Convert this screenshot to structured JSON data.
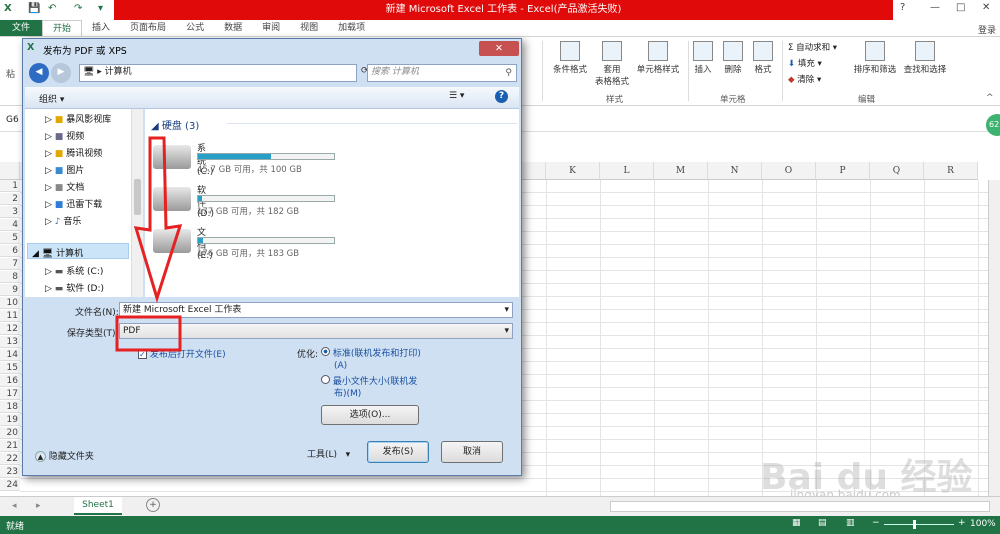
{
  "window": {
    "title": "新建 Microsoft Excel 工作表 - Excel(产品激活失败)",
    "controls": [
      "?",
      "—",
      "□",
      "✕"
    ]
  },
  "ribbon_tabs": [
    "文件",
    "开始",
    "插入",
    "页面布局",
    "公式",
    "数据",
    "审阅",
    "视图",
    "加载项"
  ],
  "signin": "登录",
  "ribbon": {
    "paste_partial": "粘",
    "styles": {
      "cond_format": "条件格式",
      "table_format_1": "套用",
      "table_format_2": "表格格式",
      "cell_style": "单元格样式",
      "group": "样式"
    },
    "cells": {
      "insert": "插入",
      "delete": "删除",
      "format": "格式",
      "group": "单元格"
    },
    "editing": {
      "autosum": "自动求和",
      "fill": "填充",
      "clear": "清除",
      "sort": "排序和筛选",
      "find": "查找和选择",
      "group": "编辑"
    }
  },
  "name_box_partial": "G6",
  "columns": [
    "K",
    "L",
    "M",
    "N",
    "O",
    "P",
    "Q",
    "R"
  ],
  "rows": [
    "1",
    "2",
    "3",
    "4",
    "5",
    "6",
    "7",
    "8",
    "9",
    "10",
    "11",
    "12",
    "13",
    "14",
    "15",
    "16",
    "17",
    "18",
    "19",
    "20",
    "21",
    "22",
    "23",
    "24"
  ],
  "sheet_tab": "Sheet1",
  "status": {
    "ready": "就绪",
    "zoom": "100%"
  },
  "dialog": {
    "title": "发布为 PDF 或 XPS",
    "breadcrumb": "计算机",
    "search_placeholder": "搜索 计算机",
    "organize": "组织",
    "section_header": "硬盘 (3)",
    "nav": [
      {
        "label": "暴风影视库",
        "icon": "folder-icon"
      },
      {
        "label": "视频",
        "icon": "video-icon"
      },
      {
        "label": "腾讯视频",
        "icon": "folder-icon"
      },
      {
        "label": "图片",
        "icon": "picture-icon"
      },
      {
        "label": "文档",
        "icon": "document-icon"
      },
      {
        "label": "迅雷下载",
        "icon": "download-icon"
      },
      {
        "label": "音乐",
        "icon": "music-icon"
      },
      {
        "label": "计算机",
        "icon": "computer-icon"
      },
      {
        "label": "系统 (C:)",
        "icon": "drive-icon"
      },
      {
        "label": "软件 (D:)",
        "icon": "drive-icon"
      }
    ],
    "drives": [
      {
        "name": "系统 (C:)",
        "info": "45.7 GB 可用，共 100 GB",
        "used": 0.54
      },
      {
        "name": "软件 (D:)",
        "info": "177 GB 可用，共 182 GB",
        "used": 0.03
      },
      {
        "name": "文档 (E:)",
        "info": "176 GB 可用，共 183 GB",
        "used": 0.04
      }
    ],
    "filename_label": "文件名(N):",
    "filename_value": "新建 Microsoft Excel 工作表",
    "filetype_label": "保存类型(T):",
    "filetype_value": "PDF",
    "open_after": "发布后打开文件(E)",
    "optimize_label": "优化:",
    "opt_standard_1": "标准(联机发布和打印)",
    "opt_standard_2": "(A)",
    "opt_min_1": "最小文件大小(联机发",
    "opt_min_2": "布)(M)",
    "options_btn": "选项(O)...",
    "hide_folders": "隐藏文件夹",
    "tools": "工具(L)",
    "publish": "发布(S)",
    "cancel": "取消"
  },
  "watermark": {
    "brand": "Bai du 经验",
    "url": "jingyan.baidu.com"
  },
  "colors": {
    "excel_green": "#217346",
    "title_red": "#e10a0a",
    "arrow_red": "#e52121"
  }
}
